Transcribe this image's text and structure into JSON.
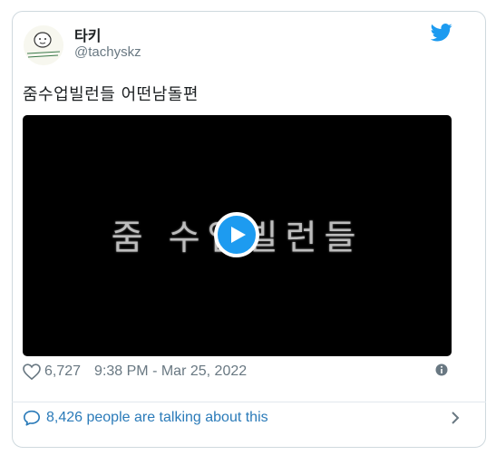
{
  "tweet": {
    "display_name": "타키",
    "handle": "@tachyskz",
    "text": "줌수업빌런들 어떤남돌편",
    "video": {
      "caption": "줌 수업빌런들"
    },
    "likes": "6,727",
    "timestamp": "9:38 PM - Mar 25, 2022",
    "conversation": "8,426 people are talking about this"
  },
  "colors": {
    "twitter_blue": "#1d9bf0",
    "link_blue": "#2b7bb9",
    "meta_gray": "#697882",
    "border": "#cfd9de"
  },
  "icons": {
    "brand": "twitter-bird-icon",
    "like": "heart-icon",
    "info": "info-icon",
    "conversation": "speech-bubble-icon",
    "chevron": "chevron-right-icon",
    "play": "play-icon"
  }
}
